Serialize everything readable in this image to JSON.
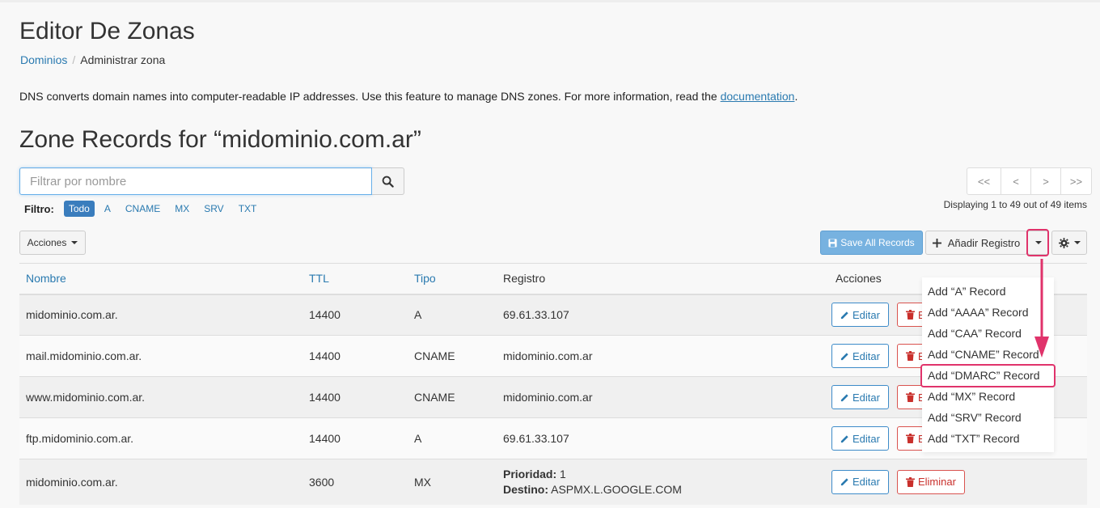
{
  "header": {
    "title": "Editor De Zonas",
    "breadcrumb": {
      "link": "Dominios",
      "separator": "/",
      "current": "Administrar zona"
    }
  },
  "intro": {
    "text": "DNS converts domain names into computer-readable IP addresses. Use this feature to manage DNS zones. For more information, read the ",
    "link": "documentation",
    "end": "."
  },
  "zone": {
    "title": "Zone Records for “midominio.com.ar”"
  },
  "search": {
    "placeholder": "Filtrar por nombre",
    "value": ""
  },
  "filters": {
    "label": "Filtro:",
    "items": [
      "Todo",
      "A",
      "CNAME",
      "MX",
      "SRV",
      "TXT"
    ],
    "active": "Todo"
  },
  "pager": {
    "first": "<<",
    "prev": "<",
    "next": ">",
    "last": ">>",
    "info": "Displaying 1 to 49 out of 49 items"
  },
  "toolbar": {
    "acciones": "Acciones",
    "save_all": "Save All Records",
    "add_record": "Añadir Registro"
  },
  "table": {
    "headers": {
      "nombre": "Nombre",
      "ttl": "TTL",
      "tipo": "Tipo",
      "registro": "Registro",
      "acciones": "Acciones"
    },
    "rows": [
      {
        "nombre": "midominio.com.ar.",
        "ttl": "14400",
        "tipo": "A",
        "registro": "69.61.33.107"
      },
      {
        "nombre": "mail.midominio.com.ar.",
        "ttl": "14400",
        "tipo": "CNAME",
        "registro": "midominio.com.ar"
      },
      {
        "nombre": "www.midominio.com.ar.",
        "ttl": "14400",
        "tipo": "CNAME",
        "registro": "midominio.com.ar"
      },
      {
        "nombre": "ftp.midominio.com.ar.",
        "ttl": "14400",
        "tipo": "A",
        "registro": "69.61.33.107"
      },
      {
        "nombre": "midominio.com.ar.",
        "ttl": "3600",
        "tipo": "MX",
        "prioridad_label": "Prioridad:",
        "prioridad": "1",
        "destino_label": "Destino:",
        "destino": "ASPMX.L.GOOGLE.COM"
      }
    ],
    "edit_label": "Editar",
    "delete_label": "Eliminar"
  },
  "dropdown": {
    "items": [
      "Add “A” Record",
      "Add “AAAA” Record",
      "Add “CAA” Record",
      "Add “CNAME” Record",
      "Add “DMARC” Record",
      "Add “MX” Record",
      "Add “SRV” Record",
      "Add “TXT” Record"
    ],
    "highlighted": "Add “DMARC” Record"
  },
  "colors": {
    "accent": "#2a7ab0",
    "highlight": "#e0336b",
    "danger": "#d9534f",
    "primary": "#77b2e0"
  },
  "icons": [
    "search-icon",
    "save-icon",
    "plus-icon",
    "caret-down-icon",
    "gear-icon",
    "pencil-icon",
    "trash-icon",
    "arrow-down-icon"
  ]
}
